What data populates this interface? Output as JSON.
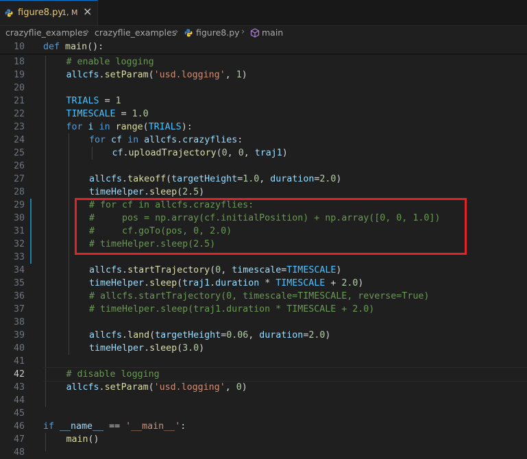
{
  "tab": {
    "title": "figure8.py",
    "badge": "1, M",
    "close": "×",
    "icon": "python-icon"
  },
  "breadcrumb": {
    "items": [
      "crazyflie_examples",
      "crazyflie_examples",
      "figure8.py",
      "main"
    ],
    "separator": "›",
    "icons": [
      "python-icon",
      "cube-icon"
    ]
  },
  "lines": [
    {
      "n": "10",
      "t": "def main():"
    },
    {
      "n": "18",
      "t": "# enable logging"
    },
    {
      "n": "19",
      "t": "allcfs.setParam('usd.logging', 1)"
    },
    {
      "n": "20",
      "t": ""
    },
    {
      "n": "21",
      "t": "TRIALS = 1"
    },
    {
      "n": "22",
      "t": "TIMESCALE = 1.0"
    },
    {
      "n": "23",
      "t": "for i in range(TRIALS):"
    },
    {
      "n": "24",
      "t": "for cf in allcfs.crazyflies:"
    },
    {
      "n": "25",
      "t": "cf.uploadTrajectory(0, 0, traj1)"
    },
    {
      "n": "26",
      "t": ""
    },
    {
      "n": "27",
      "t": "allcfs.takeoff(targetHeight=1.0, duration=2.0)"
    },
    {
      "n": "28",
      "t": "timeHelper.sleep(2.5)"
    },
    {
      "n": "29",
      "t": "# for cf in allcfs.crazyflies:"
    },
    {
      "n": "30",
      "t": "#     pos = np.array(cf.initialPosition) + np.array([0, 0, 1.0])"
    },
    {
      "n": "31",
      "t": "#     cf.goTo(pos, 0, 2.0)"
    },
    {
      "n": "32",
      "t": "# timeHelper.sleep(2.5)"
    },
    {
      "n": "33",
      "t": ""
    },
    {
      "n": "34",
      "t": "allcfs.startTrajectory(0, timescale=TIMESCALE)"
    },
    {
      "n": "35",
      "t": "timeHelper.sleep(traj1.duration * TIMESCALE + 2.0)"
    },
    {
      "n": "36",
      "t": "# allcfs.startTrajectory(0, timescale=TIMESCALE, reverse=True)"
    },
    {
      "n": "37",
      "t": "# timeHelper.sleep(traj1.duration * TIMESCALE + 2.0)"
    },
    {
      "n": "38",
      "t": ""
    },
    {
      "n": "39",
      "t": "allcfs.land(targetHeight=0.06, duration=2.0)"
    },
    {
      "n": "40",
      "t": "timeHelper.sleep(3.0)"
    },
    {
      "n": "41",
      "t": ""
    },
    {
      "n": "42",
      "t": "# disable logging"
    },
    {
      "n": "43",
      "t": "allcfs.setParam('usd.logging', 0)"
    },
    {
      "n": "44",
      "t": ""
    },
    {
      "n": "45",
      "t": ""
    },
    {
      "n": "46",
      "t": "if __name__ == '__main__':"
    },
    {
      "n": "47",
      "t": "main()"
    },
    {
      "n": "48",
      "t": ""
    }
  ],
  "active_line": "42",
  "colors": {
    "highlight_box": "#e0252a",
    "keyword": "#569cd6",
    "comment": "#6a9955",
    "string": "#ce9178",
    "number": "#b5cea8"
  }
}
